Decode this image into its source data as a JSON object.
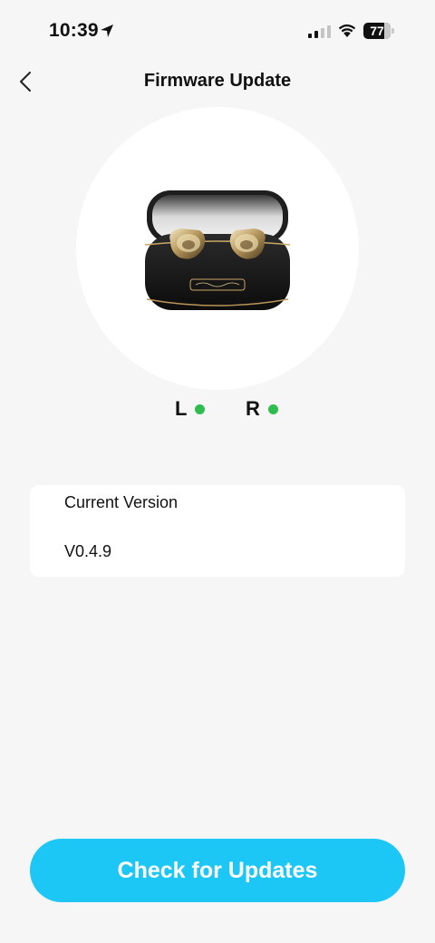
{
  "status_bar": {
    "time": "10:39",
    "battery": "77",
    "location_icon": "location-arrow-icon",
    "signal_icon": "cellular-signal-icon",
    "wifi_icon": "wifi-icon",
    "battery_icon": "battery-icon"
  },
  "nav": {
    "title": "Firmware Update",
    "back_icon": "chevron-left-icon"
  },
  "device": {
    "image": "earbuds-case-image",
    "left_label": "L",
    "right_label": "R",
    "left_status_color": "#2ebd4e",
    "right_status_color": "#2ebd4e"
  },
  "version_card": {
    "label": "Current Version",
    "value": "V0.4.9"
  },
  "actions": {
    "check_updates_label": "Check for Updates"
  },
  "colors": {
    "accent": "#1cc6f5",
    "background": "#f6f6f6",
    "connected": "#2ebd4e"
  }
}
